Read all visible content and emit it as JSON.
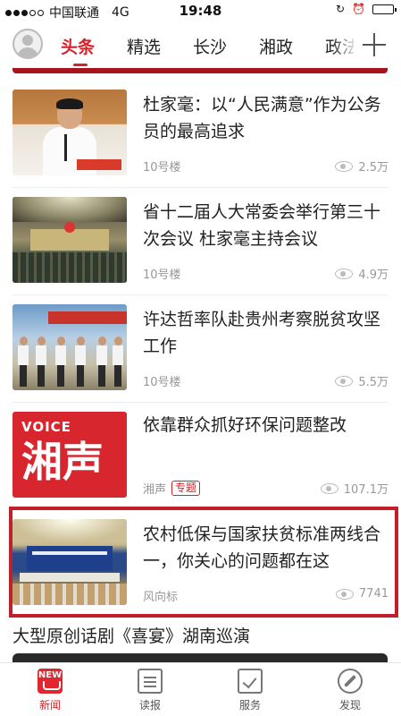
{
  "status_bar": {
    "carrier": "中国联通",
    "network": "4G",
    "time": "19:48"
  },
  "nav": {
    "tabs": [
      "头条",
      "精选",
      "长沙",
      "湘政",
      "政法"
    ],
    "active_tab": 0
  },
  "news": [
    {
      "title": "杜家毫：以“人民满意”作为公务员的最高追求",
      "source": "10号楼",
      "tag": "",
      "views": "2.5万"
    },
    {
      "title": "省十二届人大常委会举行第三十次会议 杜家毫主持会议",
      "source": "10号楼",
      "tag": "",
      "views": "4.9万"
    },
    {
      "title": "许达哲率队赴贵州考察脱贫攻坚工作",
      "source": "10号楼",
      "tag": "",
      "views": "5.5万"
    },
    {
      "title": "依靠群众抓好环保问题整改",
      "source": "湘声",
      "tag": "专题",
      "views": "107.1万",
      "thumb_text_top": "VOICE",
      "thumb_text_main": "湘声"
    },
    {
      "title": "农村低保与国家扶贫标准两线合一，你关心的问题都在这",
      "source": "风向标",
      "tag": "",
      "views": "7741"
    }
  ],
  "bottom_headline": "大型原创话剧《喜宴》湖南巡演",
  "tabbar": {
    "items": [
      {
        "label": "新闻",
        "badge": "NEW"
      },
      {
        "label": "读报"
      },
      {
        "label": "服务"
      },
      {
        "label": "发现"
      }
    ]
  },
  "colors": {
    "accent": "#d6232b",
    "highlight_border": "#c0202a"
  }
}
